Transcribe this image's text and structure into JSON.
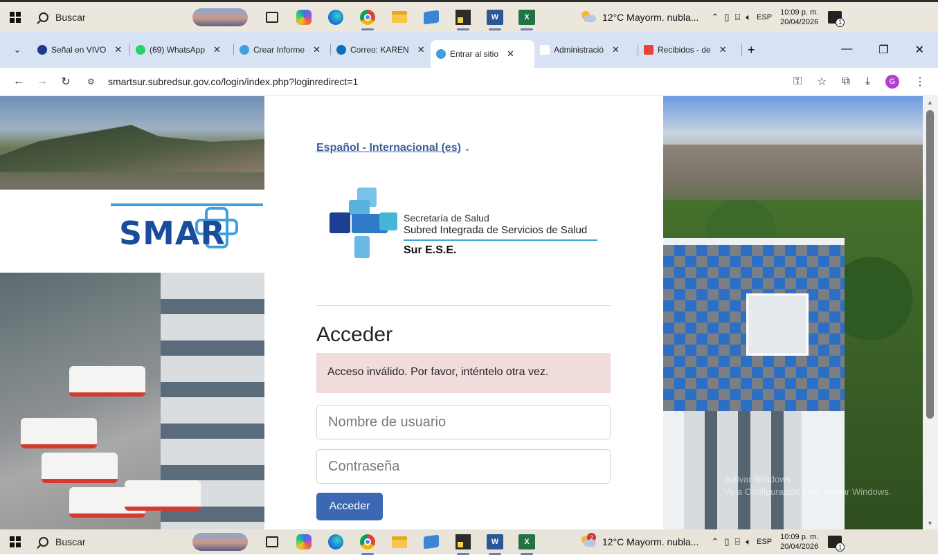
{
  "taskbar": {
    "search_label": "Buscar",
    "weather": "12°C  Mayorm. nubla...",
    "weather_badge": "2",
    "lang": "ESP",
    "time": "10:09 p. m.",
    "date": "20/04/2026",
    "notify_count": "1",
    "word_icon_text": "W",
    "excel_icon_text": "X"
  },
  "tabs": [
    {
      "title": "Señal en VIVO",
      "color": "#1f3b8c"
    },
    {
      "title": "(69) WhatsApp",
      "color": "#25d366"
    },
    {
      "title": "Crear Informe",
      "color": "#3fa0dc"
    },
    {
      "title": "Correo: KAREN",
      "color": "#0f6cbd"
    },
    {
      "title": "Entrar al sitio",
      "color": "#3fa0dc"
    },
    {
      "title": "Administració",
      "color": "#ffffff"
    },
    {
      "title": "Recibidos - de",
      "color": "#ea4335"
    }
  ],
  "address": {
    "url": "smartsur.subredsur.gov.co/login/index.php?loginredirect=1",
    "profile_initial": "G"
  },
  "login": {
    "language": "Español - Internacional (es)",
    "org_line1": "Secretaría de Salud",
    "org_line2": "Subred Integrada de Servicios de Salud",
    "org_line3": "Sur E.S.E.",
    "brand_text": "SMAR",
    "heading": "Acceder",
    "error": "Acceso inválido. Por favor, inténtelo otra vez.",
    "username_placeholder": "Nombre de usuario",
    "password_placeholder": "Contraseña",
    "submit_label": "Acceder"
  },
  "watermark": {
    "line1": "Activar Windows",
    "line2": "Ve a Configuración para activar Windows."
  },
  "colors": {
    "accent": "#3c67b3",
    "alert_bg": "#f1dcdc",
    "tabstrip": "#d7e3f4"
  }
}
